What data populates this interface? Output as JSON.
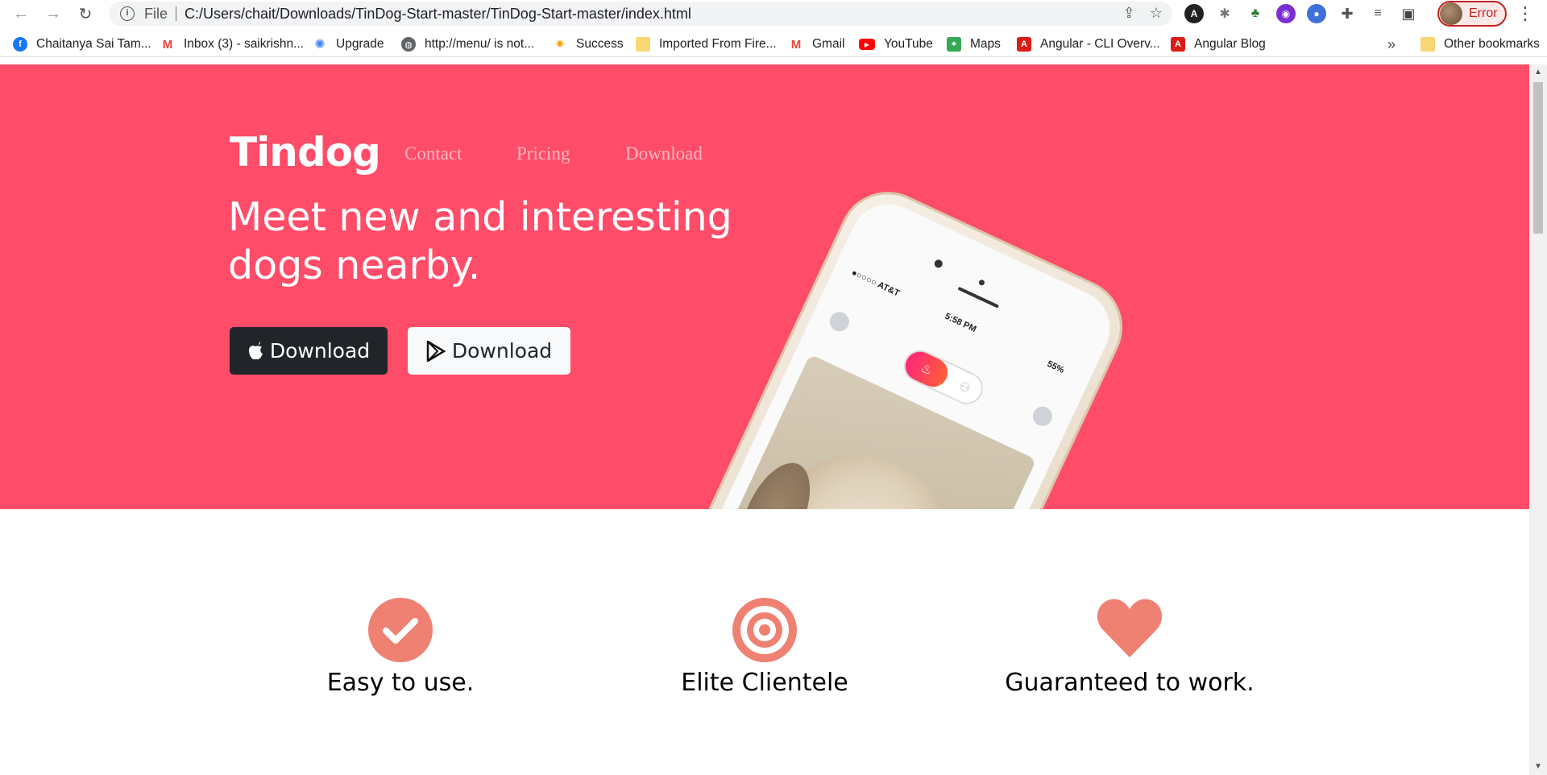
{
  "browser": {
    "url_scheme": "File",
    "url": "C:/Users/chait/Downloads/TinDog-Start-master/TinDog-Start-master/index.html",
    "profile_status": "Error",
    "bookmarks": [
      {
        "label": "Chaitanya Sai Tam...",
        "icon": "facebook-icon",
        "color": "#1877f2"
      },
      {
        "label": "Inbox (3) - saikrishn...",
        "icon": "gmail-icon",
        "color": "#ea4335"
      },
      {
        "label": "Upgrade",
        "icon": "upgrade-icon",
        "color": "#4285f4"
      },
      {
        "label": "http://menu/ is not...",
        "icon": "globe-icon",
        "color": "#5f6368"
      },
      {
        "label": "Success",
        "icon": "sun-icon",
        "color": "#f4a300"
      },
      {
        "label": "Imported From Fire...",
        "icon": "folder-icon",
        "color": "#f8d775"
      },
      {
        "label": "Gmail",
        "icon": "gmail-icon",
        "color": "#ea4335"
      },
      {
        "label": "YouTube",
        "icon": "youtube-icon",
        "color": "#ff0000"
      },
      {
        "label": "Maps",
        "icon": "maps-icon",
        "color": "#34a853"
      },
      {
        "label": "Angular - CLI Overv...",
        "icon": "angular-icon",
        "color": "#dd1b16"
      },
      {
        "label": "Angular Blog",
        "icon": "angular-icon",
        "color": "#dd1b16"
      }
    ],
    "more_bookmarks": "»",
    "other_bookmarks": "Other bookmarks"
  },
  "page": {
    "brand": "Tindog",
    "nav": [
      "Contact",
      "Pricing",
      "Download"
    ],
    "headline": "Meet new and interesting dogs nearby.",
    "download_apple": "Download",
    "download_google": "Download",
    "phone": {
      "carrier": "●○○○○ AT&T",
      "time": "5:58 PM",
      "battery": "55%"
    },
    "features": [
      {
        "title": "Easy to use.",
        "icon": "check-circle-icon"
      },
      {
        "title": "Elite Clientele",
        "icon": "bullseye-icon"
      },
      {
        "title": "Guaranteed to work.",
        "icon": "heart-icon"
      }
    ]
  },
  "colors": {
    "hero_bg": "#ff4c68",
    "feature_icon": "#ef8172",
    "dark_button": "#212529"
  }
}
